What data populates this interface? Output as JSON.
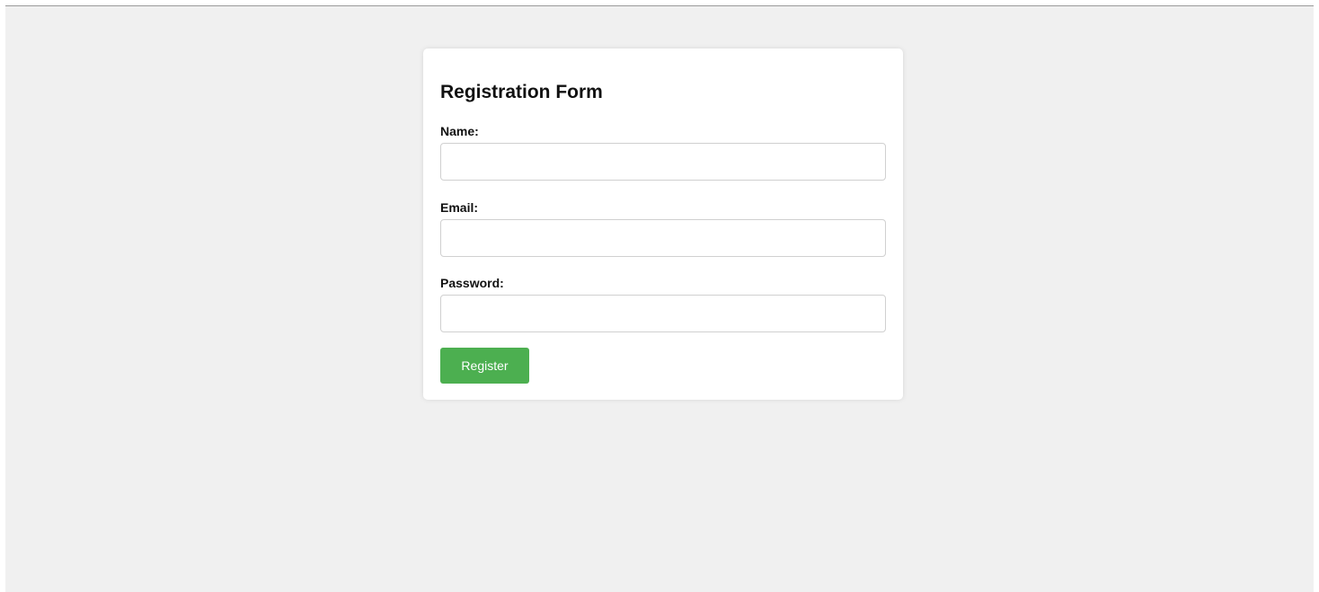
{
  "form": {
    "title": "Registration Form",
    "fields": [
      {
        "label": "Name:",
        "value": "",
        "placeholder": ""
      },
      {
        "label": "Email:",
        "value": "",
        "placeholder": ""
      },
      {
        "label": "Password:",
        "value": "",
        "placeholder": ""
      }
    ],
    "submit_label": "Register"
  },
  "colors": {
    "page_background": "#f0f0f0",
    "card_background": "#ffffff",
    "button_background": "#4caf50",
    "button_text": "#ffffff"
  }
}
